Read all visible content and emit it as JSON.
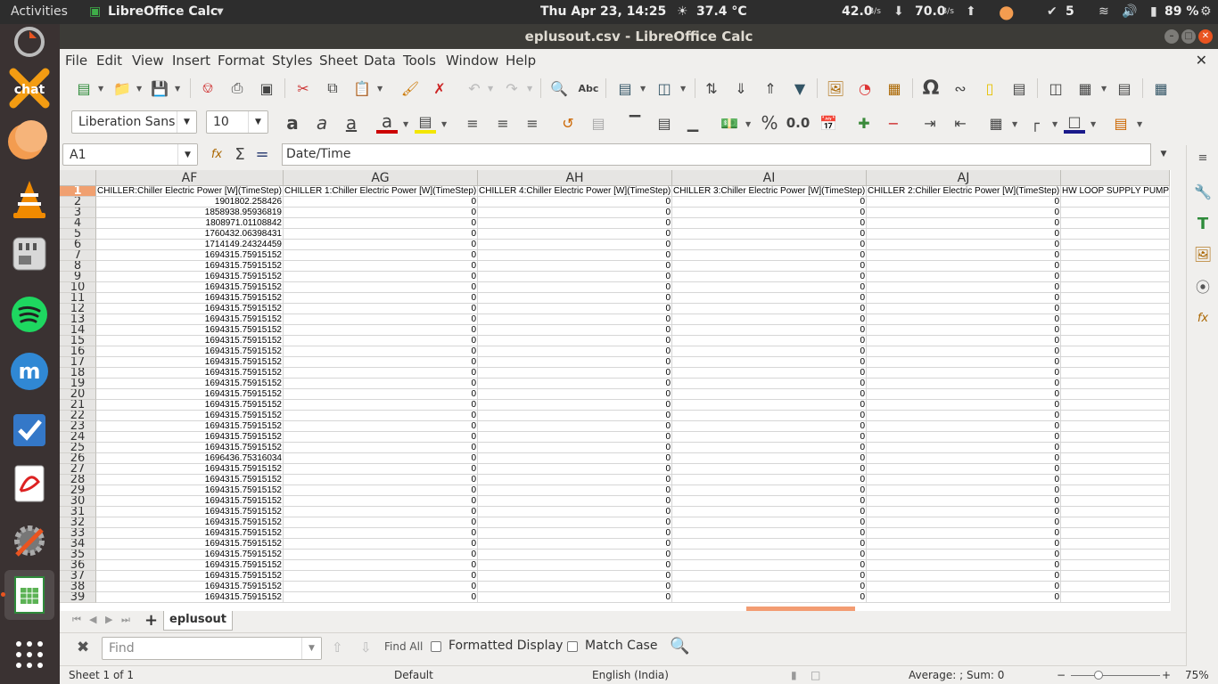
{
  "topbar": {
    "activities": "Activities",
    "app_name": "LibreOffice Calc",
    "clock": "Thu Apr 23, 14:25",
    "weather": "37.4 °C",
    "net_down": "42.0",
    "net_down_unit": "B/s",
    "net_up": "70.0",
    "net_up_unit": "B/s",
    "updates_count": "5",
    "battery": "89 %"
  },
  "window": {
    "title": "eplusout.csv - LibreOffice Calc"
  },
  "menu": [
    "File",
    "Edit",
    "View",
    "Insert",
    "Format",
    "Styles",
    "Sheet",
    "Data",
    "Tools",
    "Window",
    "Help"
  ],
  "formatting": {
    "font_name": "Liberation Sans",
    "font_size": "10",
    "percent_label": "%",
    "decimal_label": "0.0"
  },
  "formula_bar": {
    "name_box": "A1",
    "content": "Date/Time"
  },
  "sheet": {
    "columns": [
      {
        "label": "AF",
        "header": "CHILLER:Chiller Electric Power [W](TimeStep)"
      },
      {
        "label": "AG",
        "header": "CHILLER 1:Chiller Electric Power [W](TimeStep)"
      },
      {
        "label": "AH",
        "header": "CHILLER 4:Chiller Electric Power [W](TimeStep)"
      },
      {
        "label": "AI",
        "header": "CHILLER 3:Chiller Electric Power [W](TimeStep)"
      },
      {
        "label": "AJ",
        "header": "CHILLER 2:Chiller Electric Power [W](TimeStep)"
      },
      {
        "label": "",
        "header": "HW LOOP SUPPLY PUMP"
      }
    ],
    "rows": [
      {
        "n": "1"
      },
      {
        "n": "2",
        "v": [
          "1901802.258426",
          "0",
          "0",
          "0",
          "0",
          ""
        ]
      },
      {
        "n": "3",
        "v": [
          "1858938.95936819",
          "0",
          "0",
          "0",
          "0",
          ""
        ]
      },
      {
        "n": "4",
        "v": [
          "1808971.01108842",
          "0",
          "0",
          "0",
          "0",
          ""
        ]
      },
      {
        "n": "5",
        "v": [
          "1760432.06398431",
          "0",
          "0",
          "0",
          "0",
          ""
        ]
      },
      {
        "n": "6",
        "v": [
          "1714149.24324459",
          "0",
          "0",
          "0",
          "0",
          ""
        ]
      },
      {
        "n": "7",
        "v": [
          "1694315.75915152",
          "0",
          "0",
          "0",
          "0",
          ""
        ]
      },
      {
        "n": "8",
        "v": [
          "1694315.75915152",
          "0",
          "0",
          "0",
          "0",
          ""
        ]
      },
      {
        "n": "9",
        "v": [
          "1694315.75915152",
          "0",
          "0",
          "0",
          "0",
          ""
        ]
      },
      {
        "n": "10",
        "v": [
          "1694315.75915152",
          "0",
          "0",
          "0",
          "0",
          ""
        ]
      },
      {
        "n": "11",
        "v": [
          "1694315.75915152",
          "0",
          "0",
          "0",
          "0",
          ""
        ]
      },
      {
        "n": "12",
        "v": [
          "1694315.75915152",
          "0",
          "0",
          "0",
          "0",
          ""
        ]
      },
      {
        "n": "13",
        "v": [
          "1694315.75915152",
          "0",
          "0",
          "0",
          "0",
          ""
        ]
      },
      {
        "n": "14",
        "v": [
          "1694315.75915152",
          "0",
          "0",
          "0",
          "0",
          ""
        ]
      },
      {
        "n": "15",
        "v": [
          "1694315.75915152",
          "0",
          "0",
          "0",
          "0",
          ""
        ]
      },
      {
        "n": "16",
        "v": [
          "1694315.75915152",
          "0",
          "0",
          "0",
          "0",
          ""
        ]
      },
      {
        "n": "17",
        "v": [
          "1694315.75915152",
          "0",
          "0",
          "0",
          "0",
          ""
        ]
      },
      {
        "n": "18",
        "v": [
          "1694315.75915152",
          "0",
          "0",
          "0",
          "0",
          ""
        ]
      },
      {
        "n": "19",
        "v": [
          "1694315.75915152",
          "0",
          "0",
          "0",
          "0",
          ""
        ]
      },
      {
        "n": "20",
        "v": [
          "1694315.75915152",
          "0",
          "0",
          "0",
          "0",
          ""
        ]
      },
      {
        "n": "21",
        "v": [
          "1694315.75915152",
          "0",
          "0",
          "0",
          "0",
          ""
        ]
      },
      {
        "n": "22",
        "v": [
          "1694315.75915152",
          "0",
          "0",
          "0",
          "0",
          ""
        ]
      },
      {
        "n": "23",
        "v": [
          "1694315.75915152",
          "0",
          "0",
          "0",
          "0",
          ""
        ]
      },
      {
        "n": "24",
        "v": [
          "1694315.75915152",
          "0",
          "0",
          "0",
          "0",
          ""
        ]
      },
      {
        "n": "25",
        "v": [
          "1694315.75915152",
          "0",
          "0",
          "0",
          "0",
          ""
        ]
      },
      {
        "n": "26",
        "v": [
          "1696436.75316034",
          "0",
          "0",
          "0",
          "0",
          ""
        ]
      },
      {
        "n": "27",
        "v": [
          "1694315.75915152",
          "0",
          "0",
          "0",
          "0",
          ""
        ]
      },
      {
        "n": "28",
        "v": [
          "1694315.75915152",
          "0",
          "0",
          "0",
          "0",
          ""
        ]
      },
      {
        "n": "29",
        "v": [
          "1694315.75915152",
          "0",
          "0",
          "0",
          "0",
          ""
        ]
      },
      {
        "n": "30",
        "v": [
          "1694315.75915152",
          "0",
          "0",
          "0",
          "0",
          ""
        ]
      },
      {
        "n": "31",
        "v": [
          "1694315.75915152",
          "0",
          "0",
          "0",
          "0",
          ""
        ]
      },
      {
        "n": "32",
        "v": [
          "1694315.75915152",
          "0",
          "0",
          "0",
          "0",
          ""
        ]
      },
      {
        "n": "33",
        "v": [
          "1694315.75915152",
          "0",
          "0",
          "0",
          "0",
          ""
        ]
      },
      {
        "n": "34",
        "v": [
          "1694315.75915152",
          "0",
          "0",
          "0",
          "0",
          ""
        ]
      },
      {
        "n": "35",
        "v": [
          "1694315.75915152",
          "0",
          "0",
          "0",
          "0",
          ""
        ]
      },
      {
        "n": "36",
        "v": [
          "1694315.75915152",
          "0",
          "0",
          "0",
          "0",
          ""
        ]
      },
      {
        "n": "37",
        "v": [
          "1694315.75915152",
          "0",
          "0",
          "0",
          "0",
          ""
        ]
      },
      {
        "n": "38",
        "v": [
          "1694315.75915152",
          "0",
          "0",
          "0",
          "0",
          ""
        ]
      },
      {
        "n": "39",
        "v": [
          "1694315.75915152",
          "0",
          "0",
          "0",
          "0",
          ""
        ]
      }
    ],
    "tab_name": "eplusout"
  },
  "find": {
    "placeholder": "Find",
    "find_all": "Find All",
    "formatted_display": "Formatted Display",
    "match_case": "Match Case"
  },
  "status": {
    "sheet_of": "Sheet 1 of 1",
    "page_style": "Default",
    "language": "English (India)",
    "selection_summary": "Average: ; Sum: 0",
    "zoom": "75%"
  },
  "colors": {
    "accent": "#e95420",
    "selected_header": "#f0a070",
    "topbar_bg": "#2d2d2d",
    "launcher_bg": "#3a3232"
  }
}
